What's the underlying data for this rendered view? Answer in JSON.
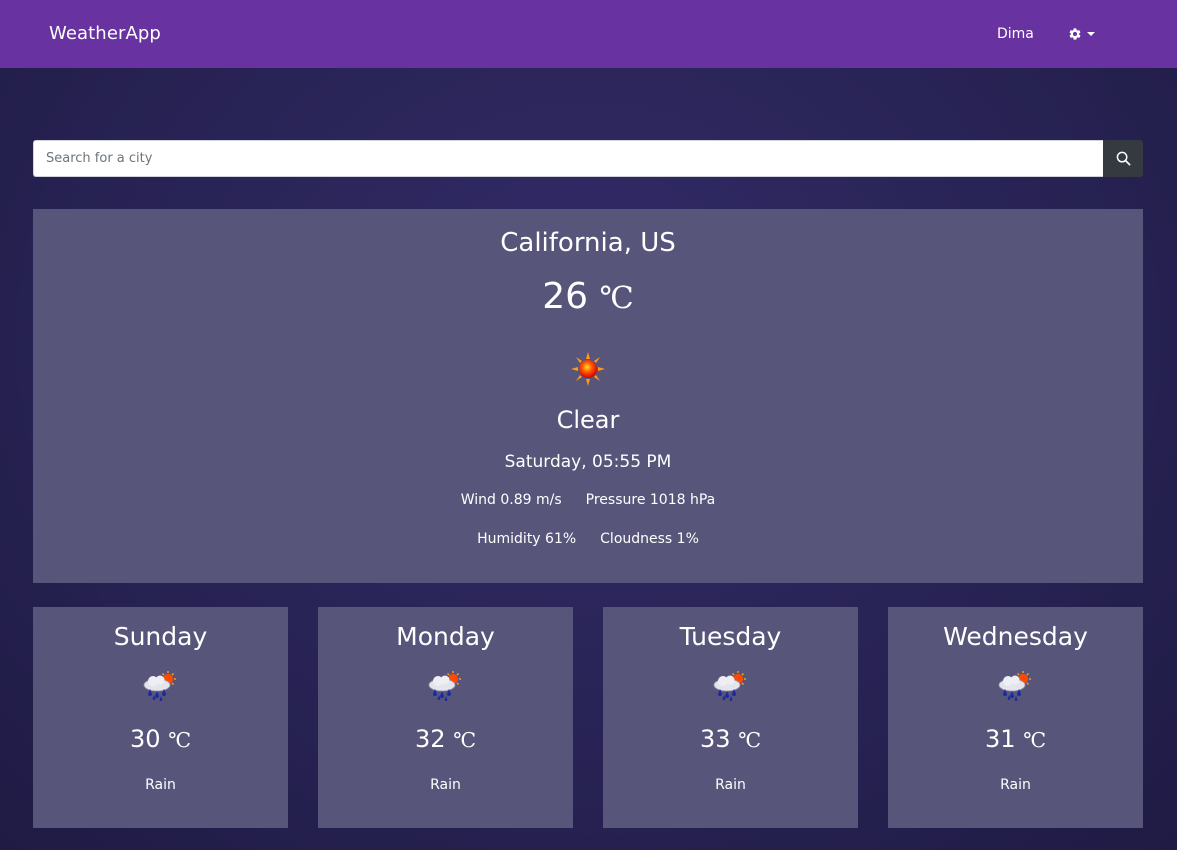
{
  "navbar": {
    "brand": "WeatherApp",
    "user": "Dima",
    "settings_icon": "gear-icon",
    "color": "#6833a0"
  },
  "search": {
    "placeholder": "Search for a city",
    "value": "",
    "button_icon": "search-icon"
  },
  "current": {
    "location": "California, US",
    "temperature": "26",
    "unit": "℃",
    "icon": "sun-icon",
    "condition": "Clear",
    "datetime": "Saturday, 05:55 PM",
    "wind": "Wind 0.89 m/s",
    "pressure": "Pressure 1018 hPa",
    "humidity": "Humidity 61%",
    "cloudiness": "Cloudness 1%"
  },
  "forecast": [
    {
      "day": "Sunday",
      "icon": "rain-sun-icon",
      "temperature": "30",
      "unit": "℃",
      "condition": "Rain"
    },
    {
      "day": "Monday",
      "icon": "rain-sun-icon",
      "temperature": "32",
      "unit": "℃",
      "condition": "Rain"
    },
    {
      "day": "Tuesday",
      "icon": "rain-sun-icon",
      "temperature": "33",
      "unit": "℃",
      "condition": "Rain"
    },
    {
      "day": "Wednesday",
      "icon": "rain-sun-icon",
      "temperature": "31",
      "unit": "℃",
      "condition": "Rain"
    }
  ],
  "colors": {
    "card_bg": "#58557a",
    "page_bg": "#2a2558",
    "search_button": "#343a40"
  }
}
